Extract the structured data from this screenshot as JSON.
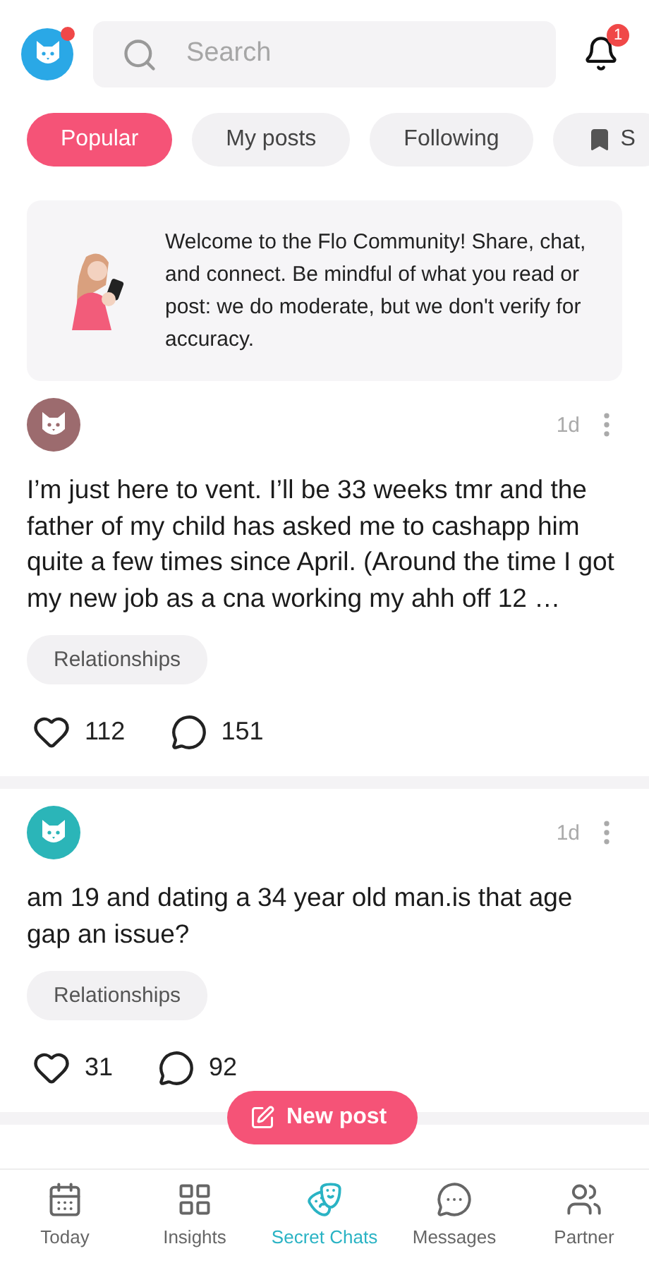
{
  "header": {
    "search": {
      "placeholder": "Search"
    },
    "notification_count": "1"
  },
  "tabs": [
    {
      "label": "Popular",
      "selected": true,
      "kind": "text"
    },
    {
      "label": "My posts",
      "selected": false,
      "kind": "text"
    },
    {
      "label": "Following",
      "selected": false,
      "kind": "text"
    },
    {
      "label": "S",
      "selected": false,
      "kind": "bookmark"
    }
  ],
  "welcome": {
    "text": "Welcome to the Flo Community! Share, chat, and connect. Be mindful of what you read or post: we do moderate, but we don't verify for accuracy."
  },
  "posts": [
    {
      "color": "#9c6b6e",
      "time": "1d",
      "text": "I’m just here to vent. I’ll be 33 weeks tmr and the father of my child has asked me to cashapp him quite a few times since April. (Around the time I got my new job as a cna working my ahh off 12 …",
      "tag": "Relationships",
      "likes": "112",
      "comments": "151"
    },
    {
      "color": "#2bb5b8",
      "time": "1d",
      "text": "am 19 and dating a 34 year old man.is that age gap an issue?",
      "tag": "Relationships",
      "likes": "31",
      "comments": "92"
    }
  ],
  "new_post": "New post",
  "nav": [
    {
      "label": "Today",
      "selected": false,
      "kind": "today"
    },
    {
      "label": "Insights",
      "selected": false,
      "kind": "insights"
    },
    {
      "label": "Secret Chats",
      "selected": true,
      "kind": "chats"
    },
    {
      "label": "Messages",
      "selected": false,
      "kind": "messages"
    },
    {
      "label": "Partner",
      "selected": false,
      "kind": "partner"
    }
  ]
}
